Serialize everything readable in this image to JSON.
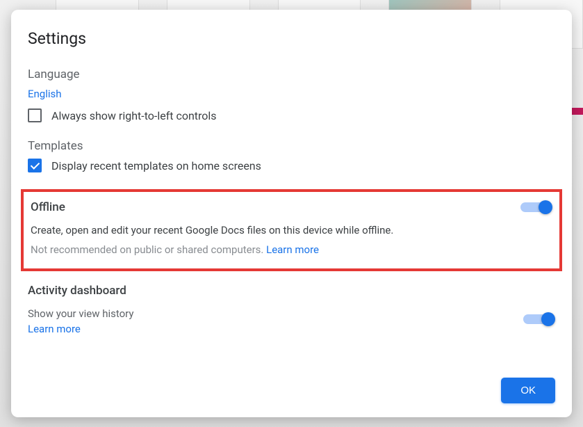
{
  "dialog": {
    "title": "Settings",
    "language": {
      "heading": "Language",
      "value": "English",
      "rtl_label": "Always show right-to-left controls",
      "rtl_checked": false
    },
    "templates": {
      "heading": "Templates",
      "display_label": "Display recent templates on home screens",
      "display_checked": true
    },
    "offline": {
      "heading": "Offline",
      "description": "Create, open and edit your recent Google Docs files on this device while offline.",
      "warning": "Not recommended on public or shared computers.",
      "learn_more": "Learn more",
      "enabled": true
    },
    "activity": {
      "heading": "Activity dashboard",
      "description": "Show your view history",
      "learn_more": "Learn more",
      "enabled": true
    },
    "ok_label": "OK"
  }
}
